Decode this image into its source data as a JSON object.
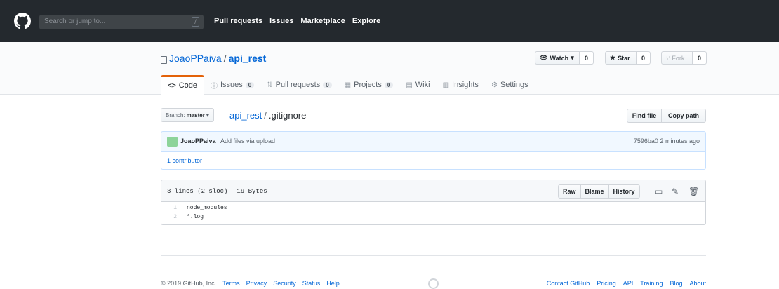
{
  "header": {
    "search_placeholder": "Search or jump to...",
    "slash_hint": "/",
    "nav": [
      "Pull requests",
      "Issues",
      "Marketplace",
      "Explore"
    ]
  },
  "repo": {
    "owner": "JoaoPPaiva",
    "separator": "/",
    "name": "api_rest",
    "watch_label": "Watch",
    "watch_count": "0",
    "star_label": "Star",
    "star_count": "0",
    "fork_label": "Fork",
    "fork_count": "0"
  },
  "tabs": [
    {
      "icon": "<>",
      "label": "Code",
      "count": ""
    },
    {
      "icon": "ⓘ",
      "label": "Issues",
      "count": "0"
    },
    {
      "icon": "⇅",
      "label": "Pull requests",
      "count": "0"
    },
    {
      "icon": "▦",
      "label": "Projects",
      "count": "0"
    },
    {
      "icon": "▤",
      "label": "Wiki",
      "count": ""
    },
    {
      "icon": "▥",
      "label": "Insights",
      "count": ""
    },
    {
      "icon": "⚙",
      "label": "Settings",
      "count": ""
    }
  ],
  "file_nav": {
    "branch_label": "Branch:",
    "branch_name": "master",
    "breadcrumb_repo": "api_rest",
    "breadcrumb_sep": "/",
    "breadcrumb_file": ".gitignore",
    "find_file": "Find file",
    "copy_path": "Copy path"
  },
  "commit": {
    "author": "JoaoPPaiva",
    "message": "Add files via upload",
    "sha": "7596ba0",
    "time": "2 minutes ago",
    "contributors": "1 contributor"
  },
  "file": {
    "lines_info": "3 lines (2 sloc)",
    "size": "19 Bytes",
    "raw": "Raw",
    "blame": "Blame",
    "history": "History",
    "lines": [
      {
        "num": "1",
        "text": "node_modules"
      },
      {
        "num": "2",
        "text": "*.log"
      }
    ]
  },
  "footer": {
    "copyright": "© 2019 GitHub, Inc.",
    "left_links": [
      "Terms",
      "Privacy",
      "Security",
      "Status",
      "Help"
    ],
    "right_links": [
      "Contact GitHub",
      "Pricing",
      "API",
      "Training",
      "Blog",
      "About"
    ]
  },
  "colors": {
    "header_bg": "#24292e",
    "link": "#0366d6",
    "tab_accent": "#e36209",
    "commit_bg": "#f1f8ff"
  }
}
